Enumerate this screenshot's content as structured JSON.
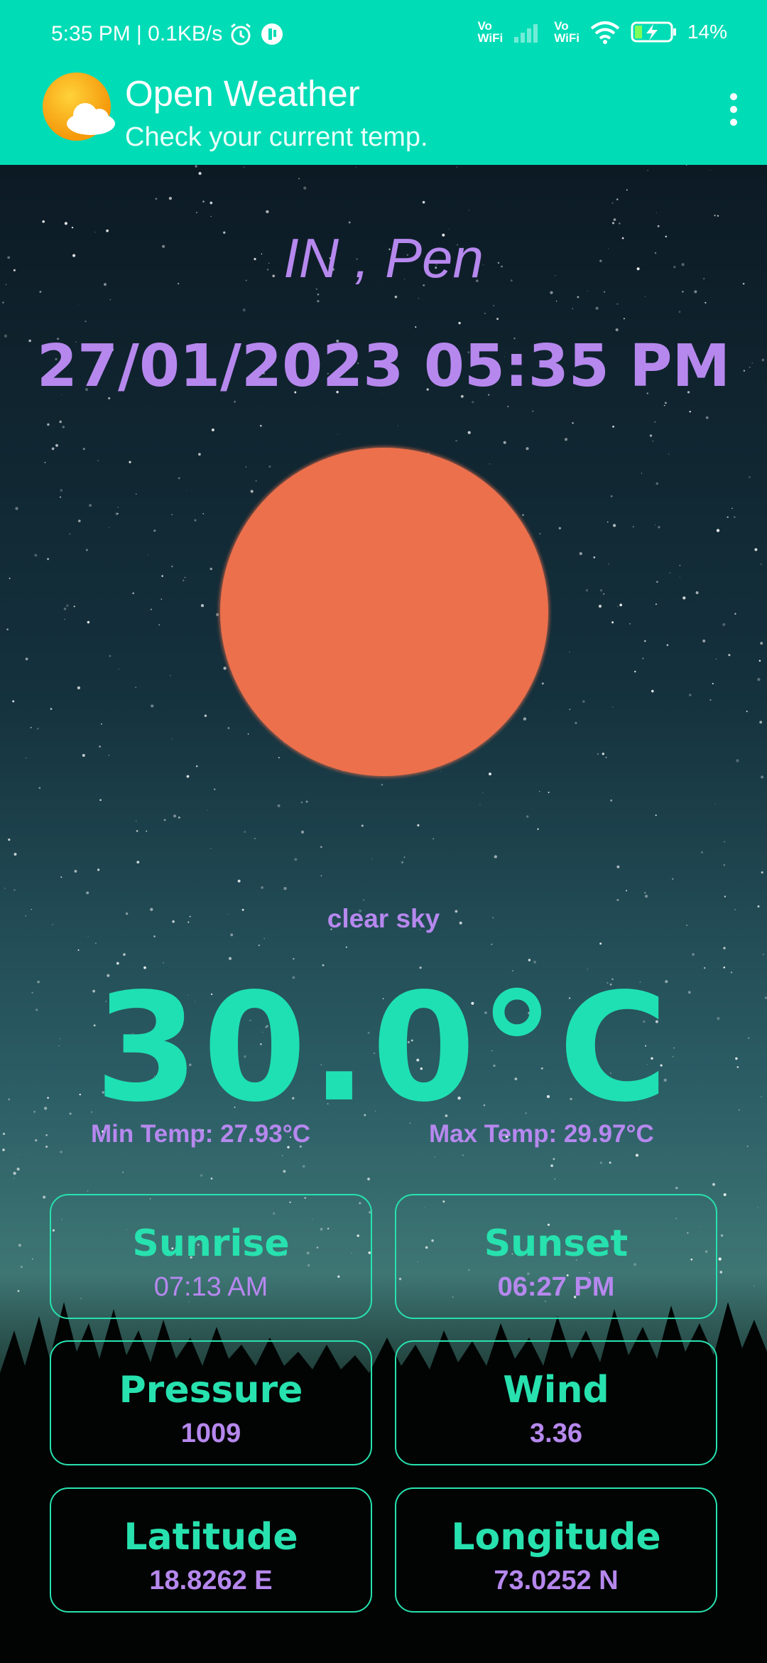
{
  "status_bar": {
    "time_speed": "5:35 PM | 0.1KB/s",
    "vowifi_1": "Vo\nWiFi",
    "vowifi_2": "Vo\nWiFi",
    "battery": "14%"
  },
  "app_bar": {
    "title": "Open Weather",
    "subtitle": "Check your current temp."
  },
  "weather": {
    "location": "IN , Pen",
    "datetime": "27/01/2023 05:35 PM",
    "description": "clear sky",
    "temperature": "30.0°C",
    "min_temp": "Min Temp: 27.93°C",
    "max_temp": "Max Temp: 29.97°C",
    "sun_color": "#ec704c"
  },
  "cards": {
    "sunrise": {
      "label": "Sunrise",
      "value": "07:13 AM"
    },
    "sunset": {
      "label": "Sunset",
      "value": "06:27 PM"
    },
    "pressure": {
      "label": "Pressure",
      "value": "1009"
    },
    "wind": {
      "label": "Wind",
      "value": "3.36"
    },
    "latitude": {
      "label": "Latitude",
      "value": "18.8262 E"
    },
    "longitude": {
      "label": "Longitude",
      "value": "73.0252 N"
    }
  },
  "colors": {
    "app_bar": "#00dcb6",
    "accent_purple": "#b688ee",
    "accent_green": "#27e1ae"
  }
}
